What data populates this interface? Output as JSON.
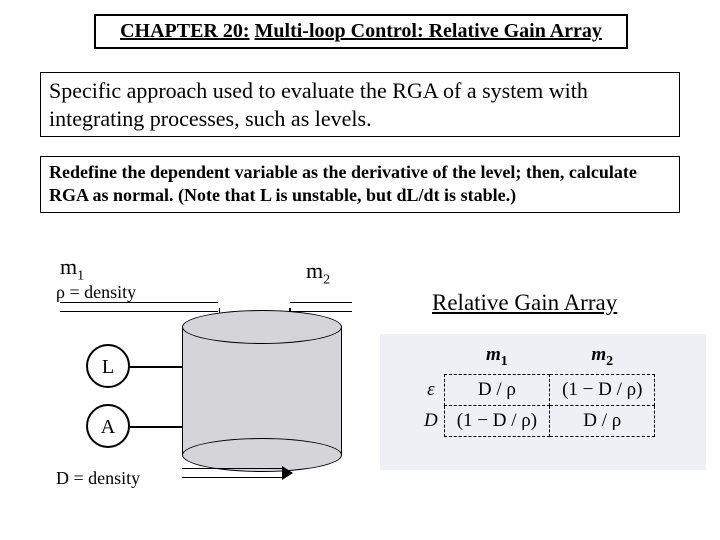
{
  "title": {
    "chapter": "CHAPTER 20:",
    "rest": "Multi-loop Control: Relative Gain Array"
  },
  "approach": "Specific approach used to evaluate the RGA of a system with integrating processes, such as levels.",
  "redefine": "Redefine the dependent variable as the derivative of the level; then, calculate RGA as normal. (Note that L is unstable, but dL/dt is stable.)",
  "labels": {
    "m1": "m",
    "m1_sub": "1",
    "m2": "m",
    "m2_sub": "2",
    "rho_density": "ρ = density",
    "L": "L",
    "A": "A",
    "D_density": "D = density"
  },
  "rga": {
    "title": "Relative Gain Array",
    "col1": "m",
    "col1_sub": "1",
    "col2": "m",
    "col2_sub": "2",
    "row1": "ε",
    "row2": "D",
    "c11": "D / ρ",
    "c12": "(1 − D / ρ)",
    "c21": "(1 − D / ρ)",
    "c22": "D / ρ"
  }
}
